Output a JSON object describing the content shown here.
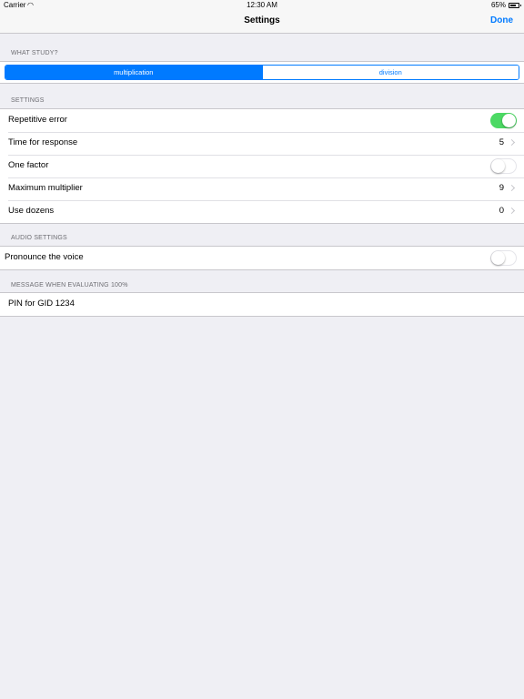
{
  "status_bar": {
    "carrier": "Carrier",
    "wifi_icon": "wifi-icon",
    "time": "12:30 AM",
    "battery_percent": "65%",
    "battery_level": 0.65
  },
  "nav": {
    "title": "Settings",
    "done_label": "Done"
  },
  "study": {
    "header": "WHAT STUDY?",
    "segments": [
      "multiplication",
      "division"
    ],
    "selected": "multiplication"
  },
  "settings": {
    "header": "SETTINGS",
    "repetitive_error": {
      "label": "Repetitive error",
      "on": true
    },
    "time_for_response": {
      "label": "Time for response",
      "value": "5"
    },
    "one_factor": {
      "label": "One factor",
      "on": false
    },
    "maximum_multiplier": {
      "label": "Maximum multiplier",
      "value": "9"
    },
    "use_dozens": {
      "label": "Use dozens",
      "value": "0"
    }
  },
  "audio": {
    "header": "AUDIO SETTINGS",
    "pronounce_voice": {
      "label": "Pronounce the voice",
      "on": false
    }
  },
  "message": {
    "header": "MESSAGE WHEN EVALUATING 100%",
    "text": "PIN for GID 1234"
  },
  "colors": {
    "accent": "#007aff",
    "toggle_on": "#4cd964",
    "background": "#efeff4"
  }
}
